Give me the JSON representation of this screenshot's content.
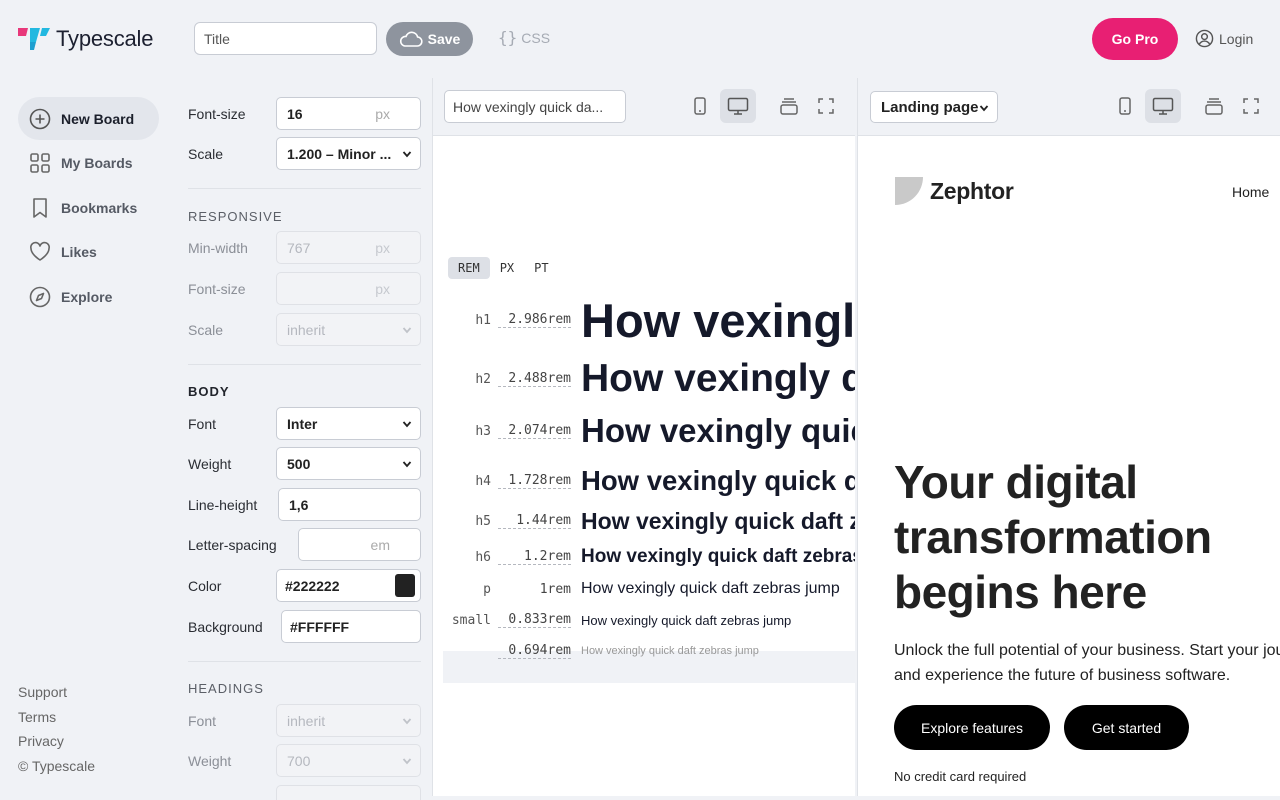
{
  "app": {
    "name": "Typescale"
  },
  "topbar": {
    "title_placeholder": "Title",
    "save_label": "Save",
    "css_label": "CSS",
    "go_pro_label": "Go Pro",
    "login_label": "Login"
  },
  "nav": {
    "items": [
      {
        "label": "New Board",
        "icon": "plus-circle-icon",
        "active": true
      },
      {
        "label": "My Boards",
        "icon": "grid-icon"
      },
      {
        "label": "Bookmarks",
        "icon": "bookmark-icon"
      },
      {
        "label": "Likes",
        "icon": "heart-icon"
      },
      {
        "label": "Explore",
        "icon": "compass-icon"
      }
    ],
    "footer": [
      "Support",
      "Terms",
      "Privacy",
      "© Typescale"
    ]
  },
  "settings": {
    "font_size_label": "Font-size",
    "font_size_value": "16",
    "unit_px": "px",
    "unit_em": "em",
    "scale_label": "Scale",
    "scale_value": "1.200 – Minor ...",
    "responsive": {
      "heading": "RESPONSIVE",
      "min_width_label": "Min-width",
      "min_width_value": "767",
      "font_size_label": "Font-size",
      "font_size_value": "",
      "scale_label": "Scale",
      "scale_value": "inherit"
    },
    "body": {
      "heading": "BODY",
      "font_label": "Font",
      "font_value": "Inter",
      "weight_label": "Weight",
      "weight_value": "500",
      "line_height_label": "Line-height",
      "line_height_value": "1,6",
      "letter_spacing_label": "Letter-spacing",
      "letter_spacing_value": "",
      "color_label": "Color",
      "color_value": "#222222",
      "background_label": "Background",
      "background_value": "#FFFFFF"
    },
    "headings": {
      "heading": "HEADINGS",
      "font_label": "Font",
      "font_value": "inherit",
      "weight_label": "Weight",
      "weight_value": "700"
    }
  },
  "preview_left": {
    "sample_text": "How vexingly quick da...",
    "unit_tabs": [
      "REM",
      "PX",
      "PT"
    ],
    "active_unit": "REM",
    "rows": [
      {
        "tag": "h1",
        "value": "2.986rem",
        "text": "How vexingly quick daft zebras jump"
      },
      {
        "tag": "h2",
        "value": "2.488rem",
        "text": "How vexingly quick daft zebras jump"
      },
      {
        "tag": "h3",
        "value": "2.074rem",
        "text": "How vexingly quick daft zebras jump"
      },
      {
        "tag": "h4",
        "value": "1.728rem",
        "text": "How vexingly quick daft zebras jump"
      },
      {
        "tag": "h5",
        "value": "1.44rem",
        "text": "How vexingly quick daft zebras jump"
      },
      {
        "tag": "h6",
        "value": "1.2rem",
        "text": "How vexingly quick daft zebras jump"
      },
      {
        "tag": "p",
        "value": "1rem",
        "text": "How vexingly quick daft zebras jump"
      },
      {
        "tag": "small",
        "value": "0.833rem",
        "text": "How vexingly quick daft zebras jump"
      },
      {
        "tag": "",
        "value": "0.694rem",
        "text": "How vexingly quick daft zebras jump"
      }
    ]
  },
  "preview_right": {
    "template_select": "Landing page",
    "brand": "Zephtor",
    "nav_home": "Home",
    "hero_title": "Your digital transformation begins here",
    "lead_line1": "Unlock the full potential of your business. Start your jou",
    "lead_line2": "and experience the future of business software.",
    "cta_primary": "Explore features",
    "cta_secondary": "Get started",
    "note": "No credit card required"
  },
  "colors": {
    "accent": "#e81f73",
    "logo_pink": "#e8387a",
    "logo_cyan": "#22b8e0",
    "swatch_color": "#222222",
    "swatch_bg": "#FFFFFF"
  }
}
